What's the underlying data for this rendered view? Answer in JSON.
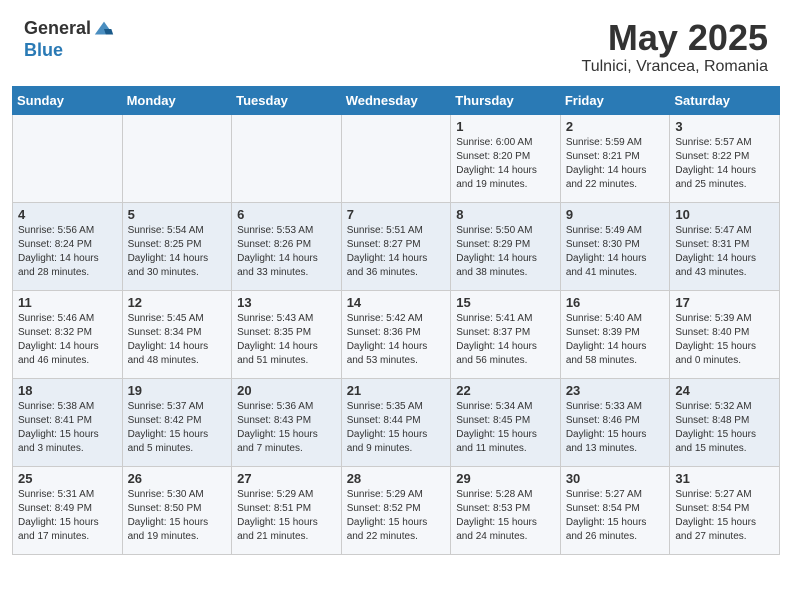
{
  "header": {
    "logo_line1": "General",
    "logo_line2": "Blue",
    "month": "May 2025",
    "location": "Tulnici, Vrancea, Romania"
  },
  "weekdays": [
    "Sunday",
    "Monday",
    "Tuesday",
    "Wednesday",
    "Thursday",
    "Friday",
    "Saturday"
  ],
  "weeks": [
    [
      {
        "day": "",
        "info": ""
      },
      {
        "day": "",
        "info": ""
      },
      {
        "day": "",
        "info": ""
      },
      {
        "day": "",
        "info": ""
      },
      {
        "day": "1",
        "info": "Sunrise: 6:00 AM\nSunset: 8:20 PM\nDaylight: 14 hours\nand 19 minutes."
      },
      {
        "day": "2",
        "info": "Sunrise: 5:59 AM\nSunset: 8:21 PM\nDaylight: 14 hours\nand 22 minutes."
      },
      {
        "day": "3",
        "info": "Sunrise: 5:57 AM\nSunset: 8:22 PM\nDaylight: 14 hours\nand 25 minutes."
      }
    ],
    [
      {
        "day": "4",
        "info": "Sunrise: 5:56 AM\nSunset: 8:24 PM\nDaylight: 14 hours\nand 28 minutes."
      },
      {
        "day": "5",
        "info": "Sunrise: 5:54 AM\nSunset: 8:25 PM\nDaylight: 14 hours\nand 30 minutes."
      },
      {
        "day": "6",
        "info": "Sunrise: 5:53 AM\nSunset: 8:26 PM\nDaylight: 14 hours\nand 33 minutes."
      },
      {
        "day": "7",
        "info": "Sunrise: 5:51 AM\nSunset: 8:27 PM\nDaylight: 14 hours\nand 36 minutes."
      },
      {
        "day": "8",
        "info": "Sunrise: 5:50 AM\nSunset: 8:29 PM\nDaylight: 14 hours\nand 38 minutes."
      },
      {
        "day": "9",
        "info": "Sunrise: 5:49 AM\nSunset: 8:30 PM\nDaylight: 14 hours\nand 41 minutes."
      },
      {
        "day": "10",
        "info": "Sunrise: 5:47 AM\nSunset: 8:31 PM\nDaylight: 14 hours\nand 43 minutes."
      }
    ],
    [
      {
        "day": "11",
        "info": "Sunrise: 5:46 AM\nSunset: 8:32 PM\nDaylight: 14 hours\nand 46 minutes."
      },
      {
        "day": "12",
        "info": "Sunrise: 5:45 AM\nSunset: 8:34 PM\nDaylight: 14 hours\nand 48 minutes."
      },
      {
        "day": "13",
        "info": "Sunrise: 5:43 AM\nSunset: 8:35 PM\nDaylight: 14 hours\nand 51 minutes."
      },
      {
        "day": "14",
        "info": "Sunrise: 5:42 AM\nSunset: 8:36 PM\nDaylight: 14 hours\nand 53 minutes."
      },
      {
        "day": "15",
        "info": "Sunrise: 5:41 AM\nSunset: 8:37 PM\nDaylight: 14 hours\nand 56 minutes."
      },
      {
        "day": "16",
        "info": "Sunrise: 5:40 AM\nSunset: 8:39 PM\nDaylight: 14 hours\nand 58 minutes."
      },
      {
        "day": "17",
        "info": "Sunrise: 5:39 AM\nSunset: 8:40 PM\nDaylight: 15 hours\nand 0 minutes."
      }
    ],
    [
      {
        "day": "18",
        "info": "Sunrise: 5:38 AM\nSunset: 8:41 PM\nDaylight: 15 hours\nand 3 minutes."
      },
      {
        "day": "19",
        "info": "Sunrise: 5:37 AM\nSunset: 8:42 PM\nDaylight: 15 hours\nand 5 minutes."
      },
      {
        "day": "20",
        "info": "Sunrise: 5:36 AM\nSunset: 8:43 PM\nDaylight: 15 hours\nand 7 minutes."
      },
      {
        "day": "21",
        "info": "Sunrise: 5:35 AM\nSunset: 8:44 PM\nDaylight: 15 hours\nand 9 minutes."
      },
      {
        "day": "22",
        "info": "Sunrise: 5:34 AM\nSunset: 8:45 PM\nDaylight: 15 hours\nand 11 minutes."
      },
      {
        "day": "23",
        "info": "Sunrise: 5:33 AM\nSunset: 8:46 PM\nDaylight: 15 hours\nand 13 minutes."
      },
      {
        "day": "24",
        "info": "Sunrise: 5:32 AM\nSunset: 8:48 PM\nDaylight: 15 hours\nand 15 minutes."
      }
    ],
    [
      {
        "day": "25",
        "info": "Sunrise: 5:31 AM\nSunset: 8:49 PM\nDaylight: 15 hours\nand 17 minutes."
      },
      {
        "day": "26",
        "info": "Sunrise: 5:30 AM\nSunset: 8:50 PM\nDaylight: 15 hours\nand 19 minutes."
      },
      {
        "day": "27",
        "info": "Sunrise: 5:29 AM\nSunset: 8:51 PM\nDaylight: 15 hours\nand 21 minutes."
      },
      {
        "day": "28",
        "info": "Sunrise: 5:29 AM\nSunset: 8:52 PM\nDaylight: 15 hours\nand 22 minutes."
      },
      {
        "day": "29",
        "info": "Sunrise: 5:28 AM\nSunset: 8:53 PM\nDaylight: 15 hours\nand 24 minutes."
      },
      {
        "day": "30",
        "info": "Sunrise: 5:27 AM\nSunset: 8:54 PM\nDaylight: 15 hours\nand 26 minutes."
      },
      {
        "day": "31",
        "info": "Sunrise: 5:27 AM\nSunset: 8:54 PM\nDaylight: 15 hours\nand 27 minutes."
      }
    ]
  ]
}
